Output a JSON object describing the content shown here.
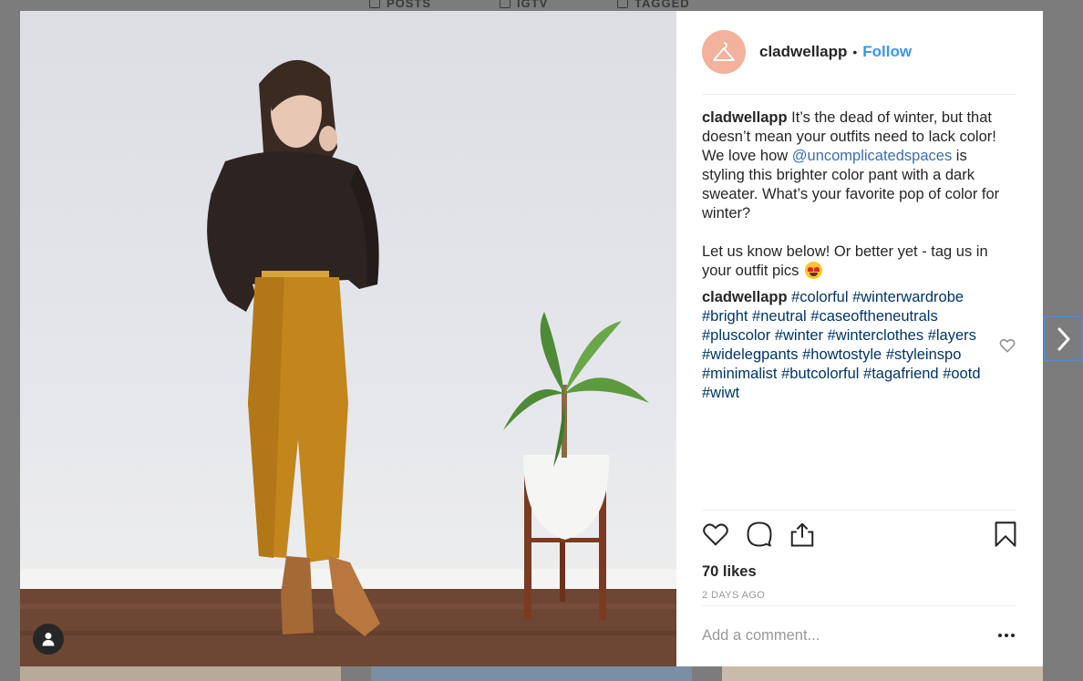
{
  "background": {
    "tabs": [
      "POSTS",
      "IGTV",
      "TAGGED"
    ]
  },
  "post": {
    "username": "cladwellapp",
    "separator": "•",
    "follow_label": "Follow",
    "caption": {
      "username": "cladwellapp",
      "text_before": "It’s the dead of winter, but that doesn’t mean your outfits need to lack color! We love how",
      "mention": "@uncomplicatedspaces",
      "text_after": "is styling this brighter color pant with a dark sweater. What’s your favorite pop of color for winter?",
      "second_paragraph": "Let us know below! Or better yet - tag us in your outfit pics"
    },
    "hashtag_comment": {
      "username": "cladwellapp",
      "hashtags": [
        "#colorful",
        "#winterwardrobe",
        "#bright",
        "#neutral",
        "#caseoftheneutrals",
        "#pluscolor",
        "#winter",
        "#winterclothes",
        "#layers",
        "#widelegpants",
        "#howtostyle",
        "#styleinspo",
        "#minimalist",
        "#butcolorful",
        "#tagafriend",
        "#ootd",
        "#wiwt"
      ]
    },
    "likes": "70 likes",
    "time_ago": "2 DAYS AGO",
    "add_comment_placeholder": "Add a comment..."
  },
  "icons": {
    "user_tag": "person-icon",
    "like": "heart-icon",
    "comment": "speech-bubble-icon",
    "share": "share-icon",
    "save": "bookmark-icon",
    "more": "ellipsis-icon",
    "next": "chevron-right-icon"
  },
  "colors": {
    "accent_link": "#3897f0",
    "hashtag": "#003569",
    "text": "#262626",
    "muted": "#999999",
    "avatar_bg": "#f2b29c"
  }
}
